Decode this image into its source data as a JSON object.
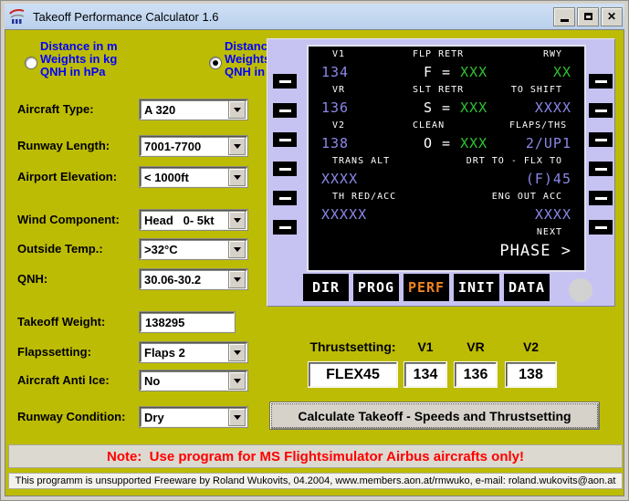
{
  "colors": {
    "olive": "#bdbc04",
    "panel": "#c6c3f2",
    "titlebar": "#cfe0f5",
    "label-blue": "#0000ff",
    "screen-blue": "#8b88e8",
    "screen-green": "#2fc42f",
    "perf-orange": "#ee8420",
    "note-red": "#ff0000"
  },
  "window": {
    "title": "Takeoff Performance Calculator 1.6"
  },
  "units": {
    "metric": {
      "lines": [
        "Distance in m",
        "Weights in kg",
        "QNH in hPa"
      ],
      "selected": false
    },
    "imperial": {
      "lines": [
        "Distance in ft",
        "Weights in lb",
        "QNH in inHg"
      ],
      "selected": true
    }
  },
  "fields": [
    {
      "label": "Aircraft Type:",
      "value": "A 320"
    },
    {
      "label": "Runway Length:",
      "value": "7001-7700"
    },
    {
      "label": "Airport Elevation:",
      "value": "< 1000ft"
    },
    {
      "label": "Wind Component:",
      "value": "Head   0- 5kt"
    },
    {
      "label": "Outside Temp.:",
      "value": ">32°C"
    },
    {
      "label": "QNH:",
      "value": "30.06-30.2"
    },
    {
      "label": "Takeoff Weight:",
      "value": "138295"
    },
    {
      "label": "Flapssetting:",
      "value": "Flaps 2"
    },
    {
      "label": "Aircraft Anti Ice:",
      "value": "No"
    },
    {
      "label": "Runway Condition:",
      "value": "Dry"
    }
  ],
  "mcdu": {
    "function_keys": [
      "DIR",
      "PROG",
      "PERF",
      "INIT",
      "DATA"
    ],
    "active_key": "PERF",
    "screen": {
      "rows": [
        {
          "l": "V1",
          "c": "FLP RETR",
          "r": "RWY"
        },
        {
          "l": "134",
          "c_pre": "F = ",
          "c_x": "XXX",
          "r": "XX"
        },
        {
          "l": "VR",
          "c": "SLT RETR",
          "r": "TO SHIFT"
        },
        {
          "l": "136",
          "c_pre": "S = ",
          "c_x": "XXX",
          "r": "XXXX"
        },
        {
          "l": "V2",
          "c": "CLEAN",
          "r": "FLAPS/THS"
        },
        {
          "l": "138",
          "c_pre": "O = ",
          "c_x": "XXX",
          "r": "2/UP1"
        },
        {
          "l": "TRANS ALT",
          "c": "",
          "r": "DRT TO - FLX TO"
        },
        {
          "l": "XXXX",
          "c_pre": "",
          "c_x": "",
          "r": "(F)45"
        },
        {
          "l": "TH RED/ACC",
          "c": "",
          "r": "ENG OUT ACC"
        },
        {
          "l": "XXXXX",
          "c_pre": "",
          "c_x": "",
          "r": "XXXX"
        },
        {
          "l": "",
          "c": "",
          "r": "NEXT"
        },
        {
          "l": "",
          "c": "",
          "r": "PHASE >"
        }
      ]
    }
  },
  "thrust": {
    "label": "Thrustsetting:",
    "v1_header": "V1",
    "vr_header": "VR",
    "v2_header": "V2",
    "thrust_value": "FLEX45",
    "v1": "134",
    "vr": "136",
    "v2": "138"
  },
  "calculate": {
    "label": "Calculate Takeoff - Speeds and Thrustsetting"
  },
  "note": {
    "text": "Note:  Use program for MS Flightsimulator Airbus aircrafts only!"
  },
  "statusbar": {
    "text": "This programm is unsupported Freeware by Roland Wukovits, 04.2004, www.members.aon.at/rmwuko, e-mail: roland.wukovits@aon.at"
  }
}
